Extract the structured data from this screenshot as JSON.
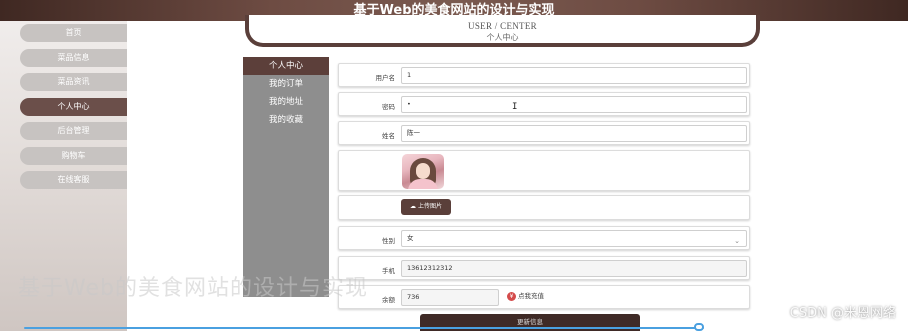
{
  "app_title": "基于Web的美食网站的设计与实现",
  "nav": {
    "items": [
      {
        "label": "首页"
      },
      {
        "label": "菜品信息"
      },
      {
        "label": "菜品资讯"
      },
      {
        "label": "个人中心"
      },
      {
        "label": "后台管理"
      },
      {
        "label": "购物车"
      },
      {
        "label": "在线客服"
      }
    ],
    "active_index": 3
  },
  "user_center": {
    "title_en": "USER / CENTER",
    "title_cn": "个人中心"
  },
  "sub_nav": {
    "items": [
      {
        "label": "个人中心"
      },
      {
        "label": "我的订单"
      },
      {
        "label": "我的地址"
      },
      {
        "label": "我的收藏"
      }
    ],
    "active_index": 0
  },
  "form": {
    "username": {
      "label": "用户名",
      "value": "1"
    },
    "password": {
      "label": "密码",
      "value": "•"
    },
    "name": {
      "label": "姓名",
      "value": "陈一"
    },
    "upload_button": "上传图片",
    "gender": {
      "label": "性别",
      "value": "女"
    },
    "phone": {
      "label": "手机",
      "value": "13612312312"
    },
    "balance": {
      "label": "余额",
      "value": "736",
      "recharge_label": "点我充值"
    },
    "submit_button": "更新信息"
  },
  "ghost_text": "基于Web的美食网站的设计与实现",
  "watermark": "CSDN @米恩网络",
  "colors": {
    "brand_dark": "#5a3f3a",
    "nav_inactive": "#c7c3c1",
    "sub_sidebar": "#8e8e8e",
    "progress": "#4aa0e0"
  }
}
